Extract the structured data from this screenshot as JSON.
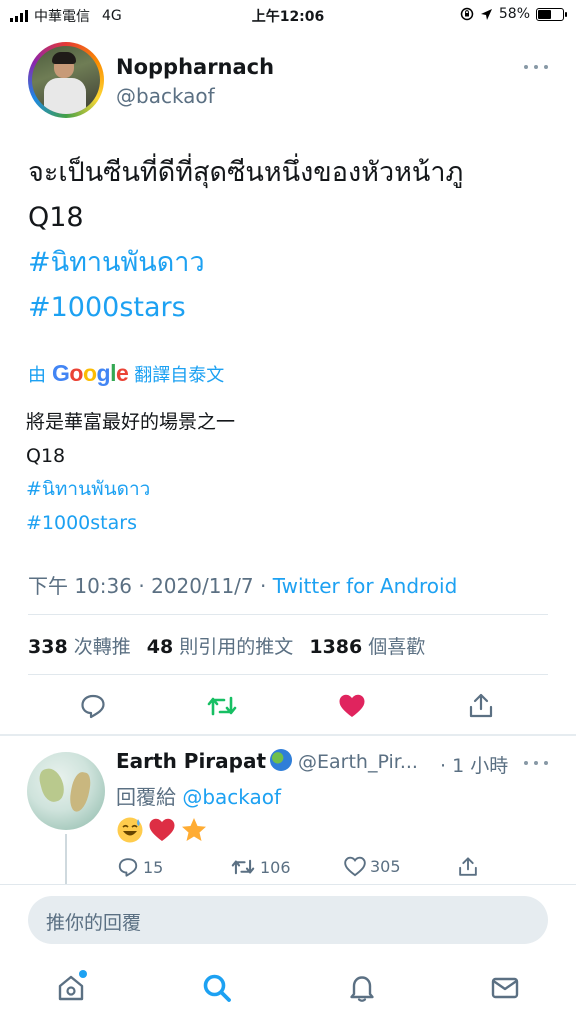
{
  "status_bar": {
    "carrier": "中華電信",
    "network": "4G",
    "time": "上午12:06",
    "battery_text": "58%",
    "battery_level": 0.58
  },
  "tweet": {
    "display_name": "Noppharnach",
    "handle": "@backaof",
    "text_line1": "จะเป็นซีนที่ดีที่สุดซีนหนึ่งของหัวหน้าภู",
    "text_line2": "Q18",
    "hashtag1": "#นิทานพันดาว",
    "hashtag2": "#1000stars",
    "translate_prefix": "由",
    "translate_suffix": "翻譯自泰文",
    "translated_line1": "將是華富最好的場景之一",
    "translated_line2": "Q18",
    "translated_hashtag1": "#นิทานพันดาว",
    "translated_hashtag2": "#1000stars",
    "time": "下午 10:36",
    "date": "2020/11/7",
    "separator": "·",
    "source": "Twitter for Android",
    "retweets_count": "338",
    "retweets_label": "次轉推",
    "quotes_count": "48",
    "quotes_label": "則引用的推文",
    "likes_count": "1386",
    "likes_label": "個喜歡"
  },
  "reply": {
    "display_name": "Earth Pirapat",
    "handle": "@Earth_Pir...",
    "time": "· 1 小時",
    "reply_to_prefix": "回覆給",
    "reply_to_handle": "@backaof",
    "emojis": [
      "sweat-smile-emoji",
      "red-heart-emoji",
      "star-emoji"
    ],
    "replies_count": "15",
    "retweets_count": "106",
    "likes_count": "305"
  },
  "compose": {
    "placeholder": "推你的回覆"
  },
  "colors": {
    "accent": "#1da1f2",
    "retweet_green": "#17bf63",
    "like_red": "#e0245e",
    "muted": "#5b7083"
  },
  "tab_bar": {
    "items": [
      "home-icon",
      "search-icon",
      "notifications-icon",
      "messages-icon"
    ]
  }
}
